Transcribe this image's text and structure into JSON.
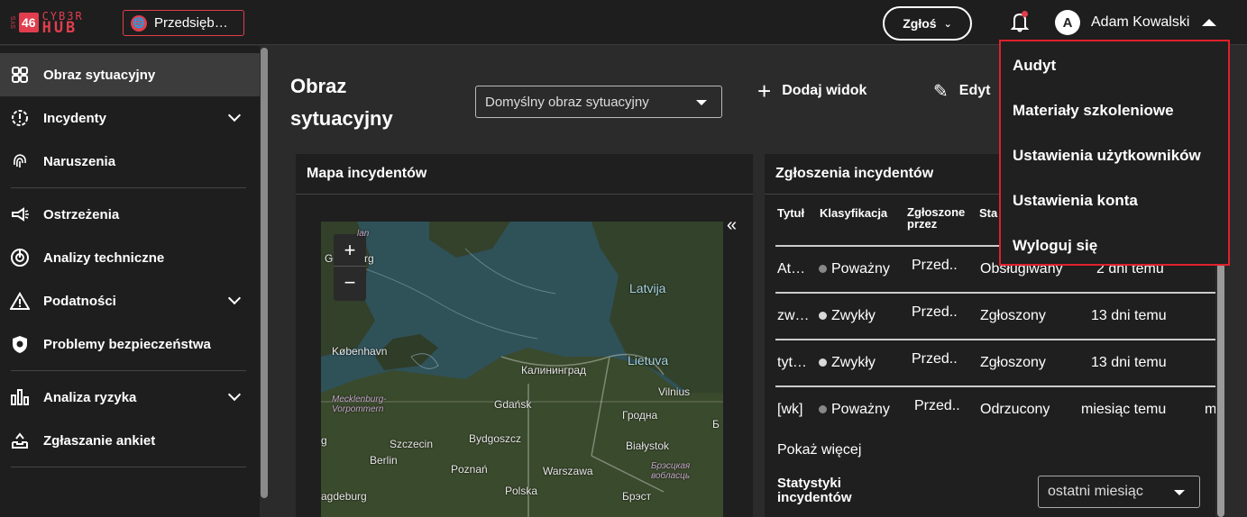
{
  "brand": {
    "sys": "SYS",
    "number": "46",
    "line1": "CYB3R",
    "line2": "HUB",
    "accent": "#e03e4e"
  },
  "header": {
    "org_label": "Przedsięb…",
    "report_button": "Zgłoś",
    "user_initial": "A",
    "user_name": "Adam Kowalski"
  },
  "sidebar": {
    "items": [
      {
        "label": "Obraz sytuacyjny",
        "icon": "dashboard-icon",
        "active": true
      },
      {
        "label": "Incydenty",
        "icon": "alert-gear-icon",
        "expandable": true
      },
      {
        "label": "Naruszenia",
        "icon": "fingerprint-icon"
      },
      {
        "label": "Ostrzeżenia",
        "icon": "megaphone-icon"
      },
      {
        "label": "Analizy techniczne",
        "icon": "radar-icon"
      },
      {
        "label": "Podatności",
        "icon": "warning-icon",
        "expandable": true
      },
      {
        "label": "Problemy bezpieczeństwa",
        "icon": "shield-icon"
      },
      {
        "label": "Analiza ryzyka",
        "icon": "bar-chart-icon",
        "expandable": true
      },
      {
        "label": "Zgłaszanie ankiet",
        "icon": "inbox-icon"
      }
    ]
  },
  "main": {
    "title": "Obraz sytuacyjny",
    "view_select": "Domyślny obraz sytuacyjny",
    "add_view": "Dodaj widok",
    "edit_view": "Edyt"
  },
  "map_panel": {
    "title": "Mapa incydentów",
    "collapse": "«",
    "zoom_in": "+",
    "zoom_out": "−",
    "labels": {
      "latvija": "Latvija",
      "lietuva": "Lietuva",
      "kobenhavn": "København",
      "kaliningrad": "Калининград",
      "vilnius": "Vilnius",
      "gdansk": "Gdańsk",
      "grodno": "Гродна",
      "mecklenburg": "Mecklenburg-Vorpommern",
      "szczecin": "Szczecin",
      "bydgoszcz": "Bydgoszcz",
      "bialystok": "Białystok",
      "berlin": "Berlin",
      "poznan": "Poznań",
      "warszawa": "Warszawa",
      "brest_region": "Брэсцкая вобласць",
      "polska": "Polska",
      "magdeburg": "agdeburg",
      "brest": "Брэст",
      "g": "g",
      "g2": "G",
      "lan": "lan",
      "rg": "rg",
      "b": "Б"
    }
  },
  "incidents_panel": {
    "title": "Zgłoszenia incydentów",
    "columns": [
      "Tytuł",
      "Klasyfikacja",
      "Zgłoszone przez",
      "Sta"
    ],
    "rows": [
      {
        "title": "At…",
        "classification": "Poważny",
        "dot": "#888888",
        "reported_by": "Przed..",
        "status": "Obsługiwany",
        "time": "2 dni temu"
      },
      {
        "title": "zw…",
        "classification": "Zwykły",
        "dot": "#d9d9d9",
        "reported_by": "Przed..",
        "status": "Zgłoszony",
        "time": "13 dni temu"
      },
      {
        "title": "tyt…",
        "classification": "Zwykły",
        "dot": "#d9d9d9",
        "reported_by": "Przed..",
        "status": "Zgłoszony",
        "time": "13 dni temu"
      },
      {
        "title": "[wk]",
        "classification": "Poważny",
        "dot": "#888888",
        "reported_by": "Przed..",
        "status": "Odrzucony",
        "time": "miesiąc temu",
        "extra": "m"
      }
    ],
    "show_more": "Pokaż więcej",
    "stats_title": "Statystyki incydentów",
    "period_select": "ostatni miesiąc"
  },
  "user_menu": {
    "items": [
      "Audyt",
      "Materiały szkoleniowe",
      "Ustawienia użytkowników",
      "Ustawienia konta",
      "Wyloguj się"
    ],
    "highlight": "#e0202c"
  }
}
